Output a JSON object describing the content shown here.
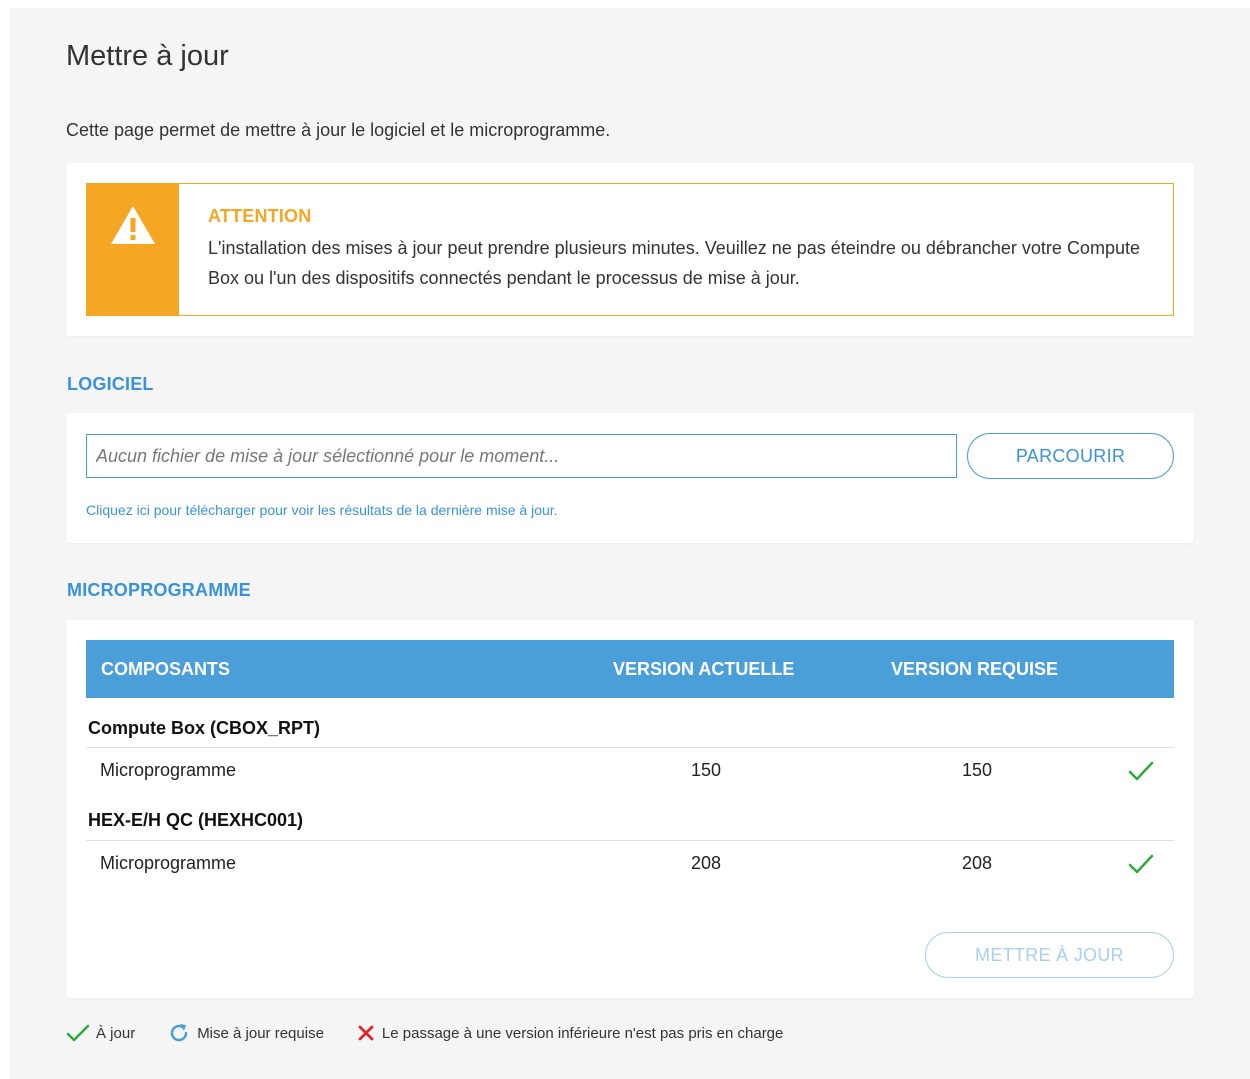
{
  "page": {
    "title": "Mettre à jour",
    "description": "Cette page permet de mettre à jour le logiciel et le microprogramme."
  },
  "warning": {
    "title": "ATTENTION",
    "body": "L'installation des mises à jour peut prendre plusieurs minutes. Veuillez ne pas éteindre ou débrancher votre Compute Box ou l'un des dispositifs connectés pendant le processus de mise à jour.",
    "icon": "warning-triangle-icon",
    "color": "#f5a623"
  },
  "software": {
    "section_title": "LOGICIEL",
    "file_placeholder": "Aucun fichier de mise à jour sélectionné pour le moment...",
    "browse_label": "PARCOURIR",
    "download_link": "Cliquez ici pour télécharger pour voir les résultats de la dernière mise à jour."
  },
  "firmware": {
    "section_title": "MICROPROGRAMME",
    "columns": [
      "COMPOSANTS",
      "VERSION ACTUELLE",
      "VERSION REQUISE"
    ],
    "groups": [
      {
        "name": "Compute Box (CBOX_RPT)",
        "rows": [
          {
            "component": "Microprogramme",
            "current": "150",
            "required": "150",
            "status": "up-to-date"
          }
        ]
      },
      {
        "name": "HEX-E/H QC (HEXHC001)",
        "rows": [
          {
            "component": "Microprogramme",
            "current": "208",
            "required": "208",
            "status": "up-to-date"
          }
        ]
      }
    ],
    "update_label": "METTRE À JOUR"
  },
  "legend": {
    "up_to_date": "À jour",
    "update_required": "Mise à jour requise",
    "downgrade_unsupported": "Le passage à une version inférieure n'est pas pris en charge"
  },
  "colors": {
    "accent": "#4a9fd9",
    "warning": "#f5a623",
    "success": "#2eaa3c",
    "error": "#e0242a"
  }
}
